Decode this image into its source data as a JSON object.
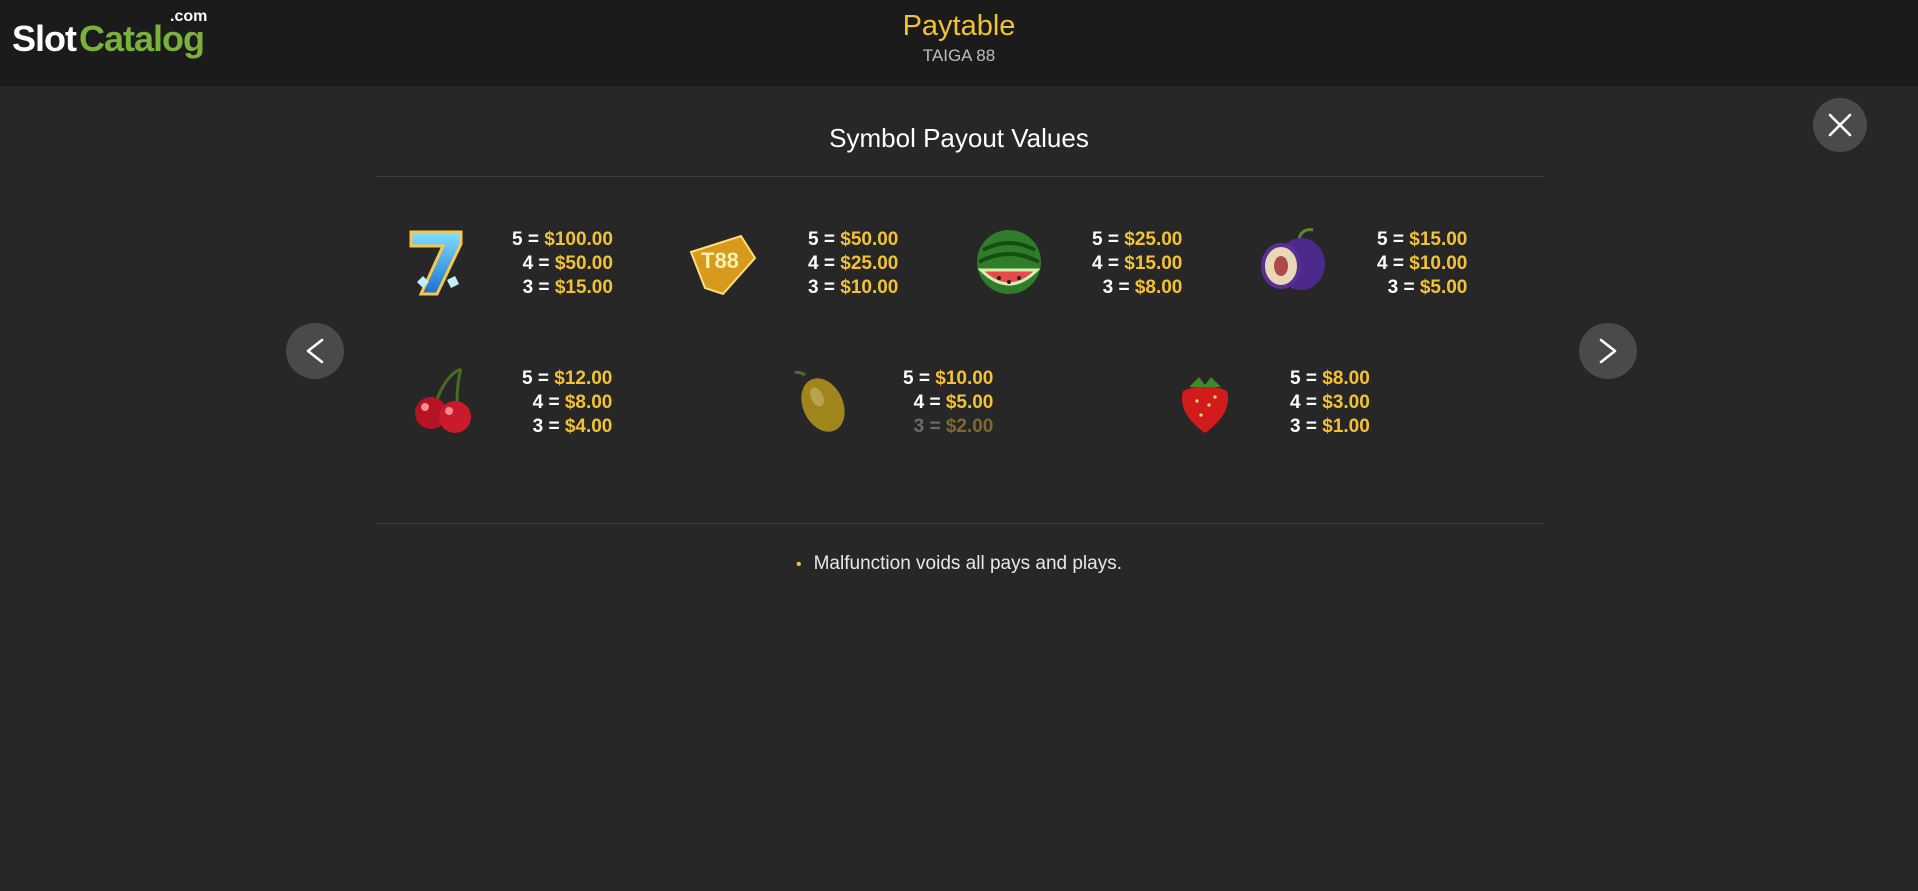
{
  "brand": {
    "slot": "Slot",
    "catalog": "Catalog",
    "com": ".com"
  },
  "header": {
    "title": "Paytable",
    "subtitle": "TAIGA 88"
  },
  "section_title": "Symbol Payout Values",
  "colors": {
    "accent": "#f2c230",
    "background": "#272727",
    "topbar": "#1b1b1b",
    "button": "#4a4a4a",
    "brand_green": "#7bb13a"
  },
  "nav": {
    "prev_icon": "chevron-left-icon",
    "next_icon": "chevron-right-icon",
    "prev_label": "<",
    "next_label": ">"
  },
  "symbols_row1": [
    {
      "icon": "seven-icon",
      "pays": [
        {
          "count": "5",
          "value": "$100.00"
        },
        {
          "count": "4",
          "value": "$50.00"
        },
        {
          "count": "3",
          "value": "$15.00"
        }
      ]
    },
    {
      "icon": "gold-88-icon",
      "pays": [
        {
          "count": "5",
          "value": "$50.00"
        },
        {
          "count": "4",
          "value": "$25.00"
        },
        {
          "count": "3",
          "value": "$10.00"
        }
      ]
    },
    {
      "icon": "watermelon-icon",
      "pays": [
        {
          "count": "5",
          "value": "$25.00"
        },
        {
          "count": "4",
          "value": "$15.00"
        },
        {
          "count": "3",
          "value": "$8.00"
        }
      ]
    },
    {
      "icon": "plum-icon",
      "pays": [
        {
          "count": "5",
          "value": "$15.00"
        },
        {
          "count": "4",
          "value": "$10.00"
        },
        {
          "count": "3",
          "value": "$5.00"
        }
      ]
    }
  ],
  "symbols_row2": [
    {
      "icon": "cherry-icon",
      "pays": [
        {
          "count": "5",
          "value": "$12.00"
        },
        {
          "count": "4",
          "value": "$8.00"
        },
        {
          "count": "3",
          "value": "$4.00"
        }
      ]
    },
    {
      "icon": "lemon-icon",
      "pays": [
        {
          "count": "5",
          "value": "$10.00"
        },
        {
          "count": "4",
          "value": "$5.00"
        },
        {
          "count": "3",
          "value": "$2.00"
        }
      ]
    },
    {
      "icon": "strawberry-icon",
      "pays": [
        {
          "count": "5",
          "value": "$8.00"
        },
        {
          "count": "4",
          "value": "$3.00"
        },
        {
          "count": "3",
          "value": "$1.00"
        }
      ]
    }
  ],
  "eq": "=",
  "notes": [
    "Malfunction voids all pays and plays."
  ],
  "bullet": "•"
}
